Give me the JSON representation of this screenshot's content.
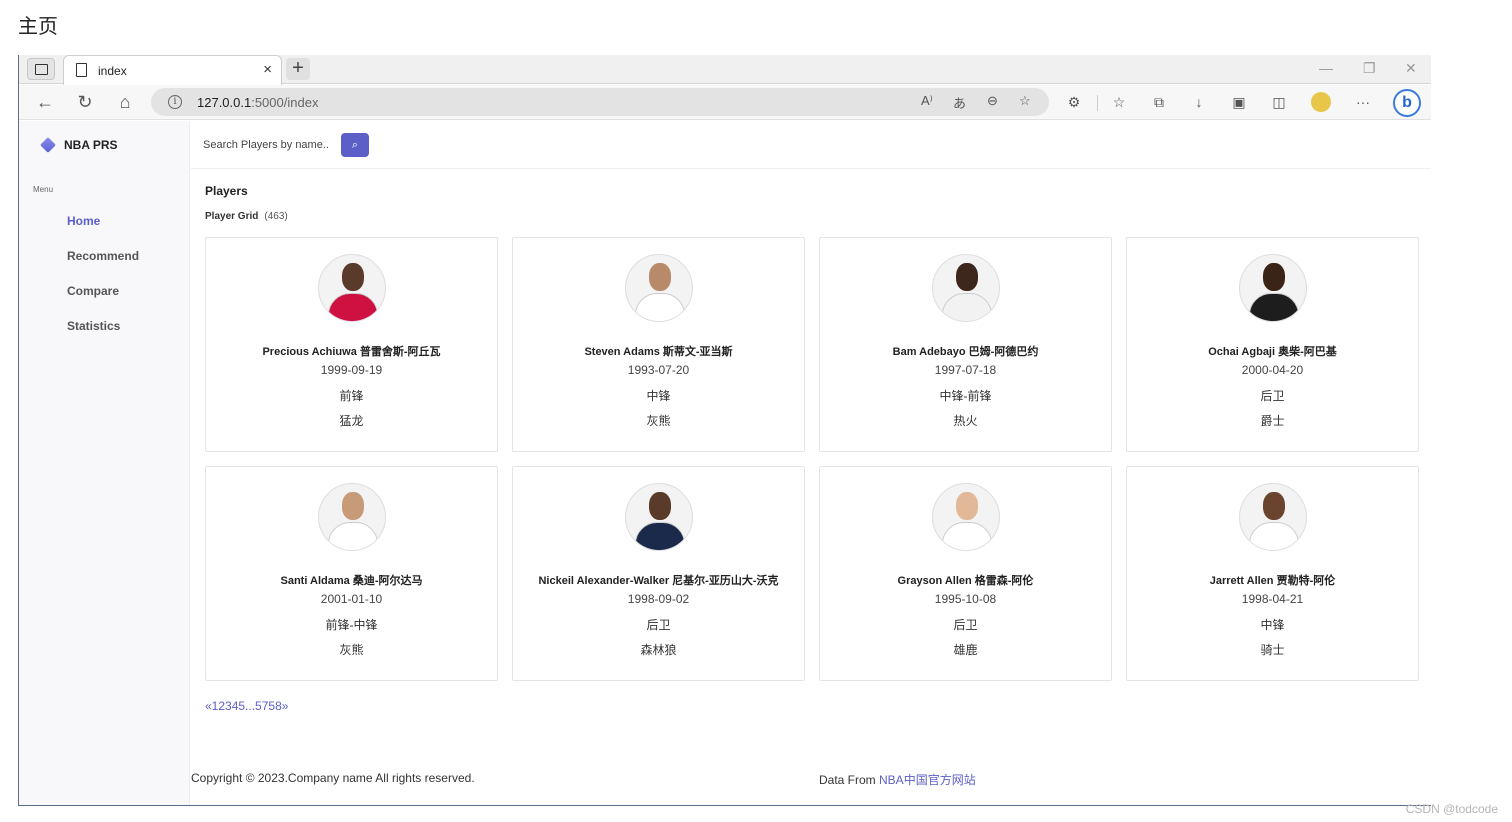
{
  "doc_heading": "主页",
  "watermark": "CSDN @todcode",
  "browser": {
    "tab_title": "index",
    "tab_close": "×",
    "new_tab": "+",
    "url_host": "127.0.0.1",
    "url_path": ":5000/index",
    "window_controls": [
      "—",
      "❐",
      "✕"
    ]
  },
  "sidebar": {
    "brand": "NBA PRS",
    "menu_label": "Menu",
    "items": [
      {
        "label": "Home",
        "active": true
      },
      {
        "label": "Recommend",
        "active": false
      },
      {
        "label": "Compare",
        "active": false
      },
      {
        "label": "Statistics",
        "active": false
      }
    ]
  },
  "search": {
    "placeholder": "Search Players by name..",
    "button_icon": "search-icon"
  },
  "main": {
    "title": "Players",
    "grid_label": "Player Grid",
    "count": "(463)"
  },
  "players": [
    {
      "name": "Precious Achiuwa 普雷舍斯-阿丘瓦",
      "dob": "1999-09-19",
      "position": "前锋",
      "team": "猛龙",
      "jersey": "#ce1141",
      "skin": "#5a3a2a"
    },
    {
      "name": "Steven Adams 斯蒂文-亚当斯",
      "dob": "1993-07-20",
      "position": "中锋",
      "team": "灰熊",
      "jersey": "#ffffff",
      "skin": "#b98a6a"
    },
    {
      "name": "Bam Adebayo 巴姆-阿德巴约",
      "dob": "1997-07-18",
      "position": "中锋-前锋",
      "team": "热火",
      "jersey": "#f2f2f2",
      "skin": "#3d261c"
    },
    {
      "name": "Ochai Agbaji 奥柴-阿巴基",
      "dob": "2000-04-20",
      "position": "后卫",
      "team": "爵士",
      "jersey": "#1d1d1d",
      "skin": "#3a2418"
    },
    {
      "name": "Santi Aldama 桑迪-阿尔达马",
      "dob": "2001-01-10",
      "position": "前锋-中锋",
      "team": "灰熊",
      "jersey": "#ffffff",
      "skin": "#c79a78"
    },
    {
      "name": "Nickeil Alexander-Walker 尼基尔-亚历山大-沃克",
      "dob": "1998-09-02",
      "position": "后卫",
      "team": "森林狼",
      "jersey": "#1b2a4a",
      "skin": "#5a3a28"
    },
    {
      "name": "Grayson Allen 格雷森-阿伦",
      "dob": "1995-10-08",
      "position": "后卫",
      "team": "雄鹿",
      "jersey": "#ffffff",
      "skin": "#e1b898"
    },
    {
      "name": "Jarrett Allen 贾勒特-阿伦",
      "dob": "1998-04-21",
      "position": "中锋",
      "team": "骑士",
      "jersey": "#ffffff",
      "skin": "#6b4430"
    }
  ],
  "pagination": "«12345...5758»",
  "footer": {
    "copyright": "Copyright © 2023.Company name All rights reserved.",
    "source_prefix": "Data From ",
    "source_link": "NBA中国官方网站"
  }
}
